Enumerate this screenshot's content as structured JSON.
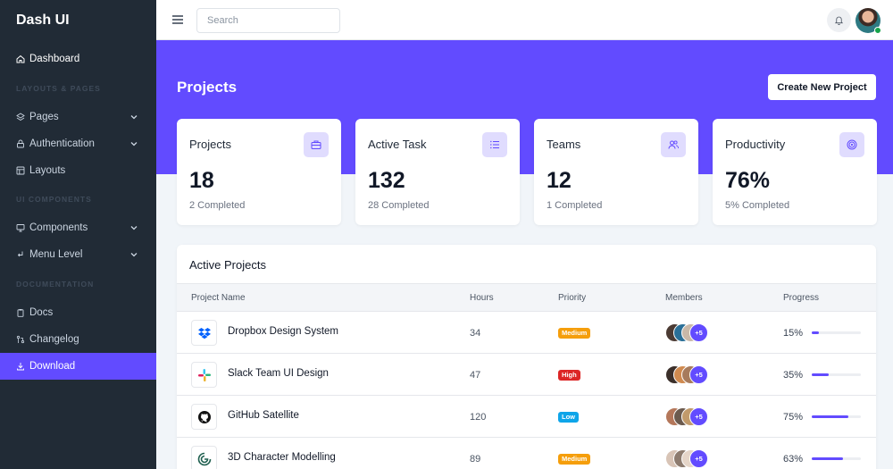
{
  "brand": "Dash UI",
  "sidebar": {
    "headings": [
      "LAYOUTS & PAGES",
      "UI COMPONENTS",
      "DOCUMENTATION"
    ],
    "items": [
      {
        "label": "Dashboard",
        "icon": "home-icon"
      },
      {
        "label": "Pages",
        "icon": "layers-icon"
      },
      {
        "label": "Authentication",
        "icon": "lock-icon"
      },
      {
        "label": "Layouts",
        "icon": "layout-icon"
      },
      {
        "label": "Components",
        "icon": "monitor-icon"
      },
      {
        "label": "Menu Level",
        "icon": "corner-left-icon"
      },
      {
        "label": "Docs",
        "icon": "clipboard-icon"
      },
      {
        "label": "Changelog",
        "icon": "git-pull-icon"
      },
      {
        "label": "Download",
        "icon": "download-icon"
      }
    ]
  },
  "topbar": {
    "search_placeholder": "Search"
  },
  "page": {
    "title": "Projects",
    "create_button": "Create New Project"
  },
  "stats": [
    {
      "title": "Projects",
      "value": "18",
      "sub": "2 Completed",
      "icon": "briefcase-icon"
    },
    {
      "title": "Active Task",
      "value": "132",
      "sub": "28 Completed",
      "icon": "list-icon"
    },
    {
      "title": "Teams",
      "value": "12",
      "sub": "1 Completed",
      "icon": "users-icon"
    },
    {
      "title": "Productivity",
      "value": "76%",
      "sub": "5% Completed",
      "icon": "target-icon"
    }
  ],
  "active_projects": {
    "title": "Active Projects",
    "columns": [
      "Project Name",
      "Hours",
      "Priority",
      "Members",
      "Progress"
    ],
    "rows": [
      {
        "name": "Dropbox Design System",
        "hours": "34",
        "priority": "Medium",
        "priority_color": "#f59e0b",
        "members_more": "+5",
        "progress": "15%",
        "progress_value": 15,
        "logo": "dropbox-logo-icon"
      },
      {
        "name": "Slack Team UI Design",
        "hours": "47",
        "priority": "High",
        "priority_color": "#dc2626",
        "members_more": "+5",
        "progress": "35%",
        "progress_value": 35,
        "logo": "slack-logo-icon"
      },
      {
        "name": "GitHub Satellite",
        "hours": "120",
        "priority": "Low",
        "priority_color": "#0ea5e9",
        "members_more": "+5",
        "progress": "75%",
        "progress_value": 75,
        "logo": "github-logo-icon"
      },
      {
        "name": "3D Character Modelling",
        "hours": "89",
        "priority": "Medium",
        "priority_color": "#f59e0b",
        "members_more": "+5",
        "progress": "63%",
        "progress_value": 63,
        "logo": "threed-logo-icon"
      }
    ]
  },
  "colors": {
    "accent": "#624bff",
    "sidebar_bg": "#212b36"
  }
}
